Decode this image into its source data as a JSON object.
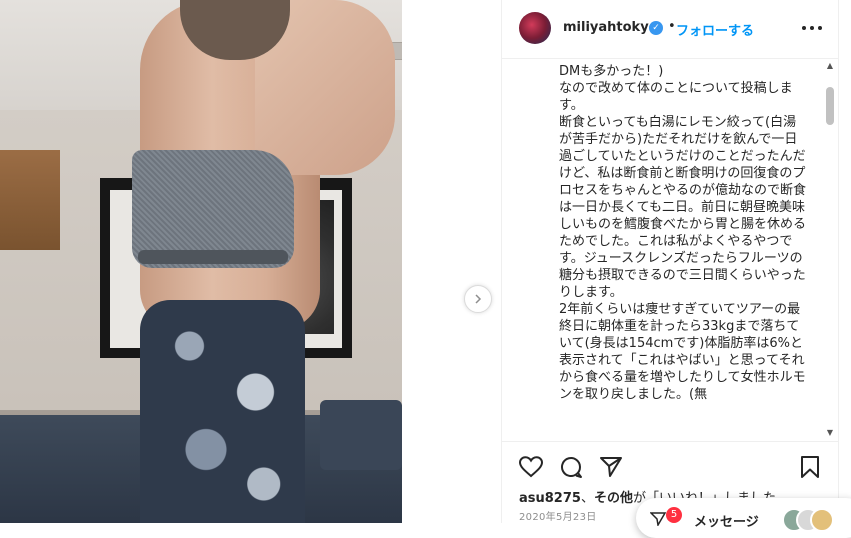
{
  "post": {
    "username": "miliyahtokyo",
    "follow_label": "フォローする",
    "dot": "•",
    "verified_glyph": "✓"
  },
  "caption": {
    "lines": [
      "DMも多かった！)",
      "なので改めて体のことについて投稿します。",
      "断食といっても白湯にレモン絞って(白湯が苦手だから)ただそれだけを飲んで一日過ごしていたというだけのことだったんだけど、私は断食前と断食明けの回復食のプロセスをちゃんとやるのが億劫なので断食は一日か長くても二日。前日に朝昼晩美味しいものを鱈腹食べたから胃と腸を休めるためでした。これは私がよくやるやつです。ジュースクレンズだったらフルーツの糖分も摂取できるので三日間くらいやったりします。",
      "2年前くらいは痩せすぎていてツアーの最終日に朝体重を計ったら33kgまで落ちていて(身長は154cmです)体脂肪率は6%と表示されて「これはやばい」と思ってそれから食べる量を増やしたりして女性ホルモンを取り戻しました。(無"
    ]
  },
  "likes": {
    "user": "asu8275",
    "others": "その他",
    "suffix": "が「いいね！」しました"
  },
  "date": "2020年5月23日",
  "chat_pill": {
    "badge": "5",
    "label": "メッセージ"
  },
  "colors": {
    "follow": "#0095f6",
    "verified": "#3897f0",
    "badge": "#ff3040"
  },
  "icons": [
    "more-icon",
    "heart-icon",
    "comment-icon",
    "share-icon",
    "bookmark-icon",
    "next-arrow-icon",
    "message-icon"
  ]
}
